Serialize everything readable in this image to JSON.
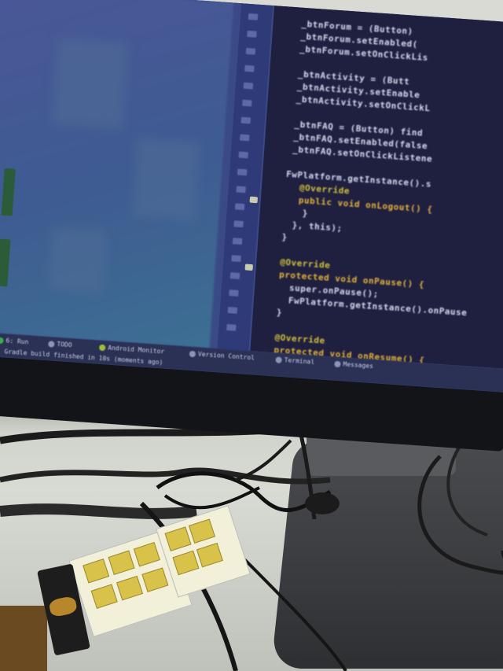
{
  "photo": {
    "subject": "",
    "colors": {
      "editor_bg": "#1f2040",
      "keyword": "#e8b53a",
      "identifier": "#d9dcf2",
      "method": "#c8cde8",
      "string": "#e06a6a",
      "annotation": "#d4c23a"
    }
  },
  "code_lines": [
    {
      "text": "_btnForum = (Button)",
      "color": "identifier"
    },
    {
      "text": "_btnForum.setEnabled(",
      "color": "identifier"
    },
    {
      "text": "_btnForum.setOnClickLis",
      "color": "identifier"
    },
    {
      "text": "",
      "color": "identifier"
    },
    {
      "text": "_btnActivity = (Butt",
      "color": "identifier"
    },
    {
      "text": "_btnActivity.setEnable",
      "color": "identifier"
    },
    {
      "text": "_btnActivity.setOnClickL",
      "color": "identifier"
    },
    {
      "text": "",
      "color": "identifier"
    },
    {
      "text": "_btnFAQ = (Button) find",
      "color": "identifier"
    },
    {
      "text": "_btnFAQ.setEnabled(false",
      "color": "identifier"
    },
    {
      "text": "_btnFAQ.setOnClickListene",
      "color": "identifier"
    },
    {
      "text": "",
      "color": "identifier"
    },
    {
      "text": "FwPlatform.getInstance().s",
      "color": "identifier"
    },
    {
      "text": "@Override",
      "color": "annotation"
    },
    {
      "text": "public void onLogout() {",
      "color": "keyword"
    },
    {
      "text": "}",
      "color": "identifier"
    },
    {
      "text": "}, this);",
      "color": "identifier"
    },
    {
      "text": "}",
      "color": "identifier"
    },
    {
      "text": "",
      "color": "identifier"
    },
    {
      "text": "@Override",
      "color": "annotation"
    },
    {
      "text": "protected void onPause() {",
      "color": "keyword"
    },
    {
      "text": "super.onPause();",
      "color": "identifier"
    },
    {
      "text": "FwPlatform.getInstance().onPause",
      "color": "identifier"
    },
    {
      "text": "}",
      "color": "identifier"
    },
    {
      "text": "",
      "color": "identifier"
    },
    {
      "text": "@Override",
      "color": "annotation"
    },
    {
      "text": "protected void onResume() {",
      "color": "keyword"
    }
  ],
  "status_bar": [
    {
      "label": "6: Run",
      "dot": "#3cae4e"
    },
    {
      "label": "TODO",
      "dot": "#8e95b8"
    },
    {
      "label": "Android Monitor",
      "dot": "#9fbf3b"
    },
    {
      "label": "Version Control",
      "dot": "#8e95b8"
    },
    {
      "label": "Terminal",
      "dot": "#8e95b8"
    },
    {
      "label": "Messages",
      "dot": "#8e95b8"
    }
  ],
  "status_message": "Gradle build finished in 10s (moments ago)"
}
